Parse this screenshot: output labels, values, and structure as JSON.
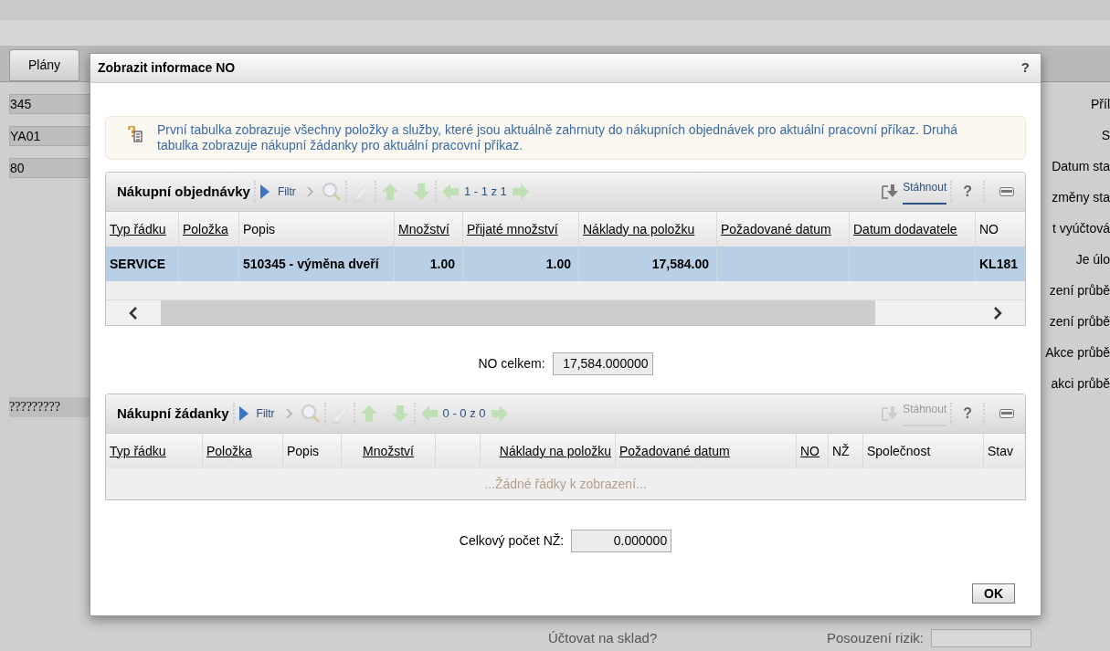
{
  "background": {
    "tab": "Plány",
    "left_fields": [
      "345",
      "YA01",
      "80"
    ],
    "left_marks": "?????????",
    "right_labels": [
      "Příl",
      "S",
      "Datum sta",
      "změny sta",
      "t vyúčtová",
      "Je úlo",
      "zení průbě",
      "zení průbě",
      "Akce průbě",
      "akci průbě"
    ],
    "bottom_left": "Účtovat na sklad?",
    "bottom_right": "Posouzení rizik:"
  },
  "dialog": {
    "title": "Zobrazit informace NO",
    "help": "?",
    "info": "První tabulka zobrazuje všechny položky a služby, které jsou aktuálně zahrnuty do nákupních objednávek pro aktuální pracovní příkaz. Druhá tabulka zobrazuje nákupní žádanky pro aktuální pracovní příkaz.",
    "tables": [
      {
        "title": "Nákupní objednávky",
        "filter": "Filtr",
        "paging": "1 - 1 z 1",
        "download": "Stáhnout",
        "download_enabled": true,
        "help": "?",
        "scrollbar": true,
        "columns": [
          {
            "label": "Typ řádku",
            "sortable": true
          },
          {
            "label": "Položka",
            "sortable": true
          },
          {
            "label": "Popis",
            "sortable": false
          },
          {
            "label": "Množství",
            "sortable": true
          },
          {
            "label": "Přijaté množství",
            "sortable": true
          },
          {
            "label": "Náklady na položku",
            "sortable": true
          },
          {
            "label": "Požadované datum",
            "sortable": true
          },
          {
            "label": "Datum dodavatele",
            "sortable": true
          },
          {
            "label": "NO",
            "sortable": false
          }
        ],
        "rows": [
          {
            "selected": true,
            "cells": [
              "SERVICE",
              "",
              "510345 - výměna dveří",
              "1.00",
              "1.00",
              "17,584.00",
              "",
              "",
              "KL181"
            ]
          }
        ],
        "total_label": "NO celkem:",
        "total": "17,584.000000"
      },
      {
        "title": "Nákupní žádanky",
        "filter": "Filtr",
        "paging": "0 - 0 z 0",
        "download": "Stáhnout",
        "download_enabled": false,
        "help": "?",
        "columns": [
          {
            "label": "Typ řádku",
            "sortable": true
          },
          {
            "label": "Položka",
            "sortable": true
          },
          {
            "label": "Popis",
            "sortable": false
          },
          {
            "label": "Množství",
            "sortable": true
          },
          {
            "label": "Náklady na položku",
            "sortable": true
          },
          {
            "label": "Požadované datum",
            "sortable": true
          },
          {
            "label": "NO",
            "sortable": true
          },
          {
            "label": "NŽ",
            "sortable": false
          },
          {
            "label": "Společnost",
            "sortable": false
          },
          {
            "label": "Stav",
            "sortable": false
          }
        ],
        "empty": "...Žádné řádky k zobrazení...",
        "total_label": "Celkový počet NŽ:",
        "total": "0.000000"
      }
    ],
    "ok": "OK"
  }
}
